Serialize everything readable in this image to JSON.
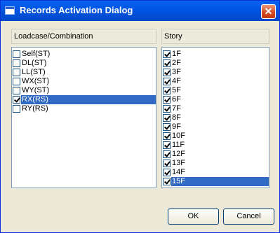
{
  "window": {
    "title": "Records Activation Dialog",
    "close_glyph": "✕"
  },
  "left_panel": {
    "header": "Loadcase/Combination",
    "items": [
      {
        "label": "Self(ST)",
        "checked": false,
        "selected": false
      },
      {
        "label": "DL(ST)",
        "checked": false,
        "selected": false
      },
      {
        "label": "LL(ST)",
        "checked": false,
        "selected": false
      },
      {
        "label": "WX(ST)",
        "checked": false,
        "selected": false
      },
      {
        "label": "WY(ST)",
        "checked": false,
        "selected": false
      },
      {
        "label": "RX(RS)",
        "checked": true,
        "selected": true
      },
      {
        "label": "RY(RS)",
        "checked": false,
        "selected": false
      }
    ]
  },
  "right_panel": {
    "header": "Story",
    "items": [
      {
        "label": "1F",
        "checked": true,
        "selected": false
      },
      {
        "label": "2F",
        "checked": true,
        "selected": false
      },
      {
        "label": "3F",
        "checked": true,
        "selected": false
      },
      {
        "label": "4F",
        "checked": true,
        "selected": false
      },
      {
        "label": "5F",
        "checked": true,
        "selected": false
      },
      {
        "label": "6F",
        "checked": true,
        "selected": false
      },
      {
        "label": "7F",
        "checked": true,
        "selected": false
      },
      {
        "label": "8F",
        "checked": true,
        "selected": false
      },
      {
        "label": "9F",
        "checked": true,
        "selected": false
      },
      {
        "label": "10F",
        "checked": true,
        "selected": false
      },
      {
        "label": "11F",
        "checked": true,
        "selected": false
      },
      {
        "label": "12F",
        "checked": true,
        "selected": false
      },
      {
        "label": "13F",
        "checked": true,
        "selected": false
      },
      {
        "label": "14F",
        "checked": true,
        "selected": false
      },
      {
        "label": "15F",
        "checked": true,
        "selected": true
      }
    ]
  },
  "buttons": {
    "ok": "OK",
    "cancel": "Cancel"
  },
  "colors": {
    "selection": "#316ac5",
    "titlebar": "#0054e3",
    "dialog_bg": "#ece9d8"
  }
}
